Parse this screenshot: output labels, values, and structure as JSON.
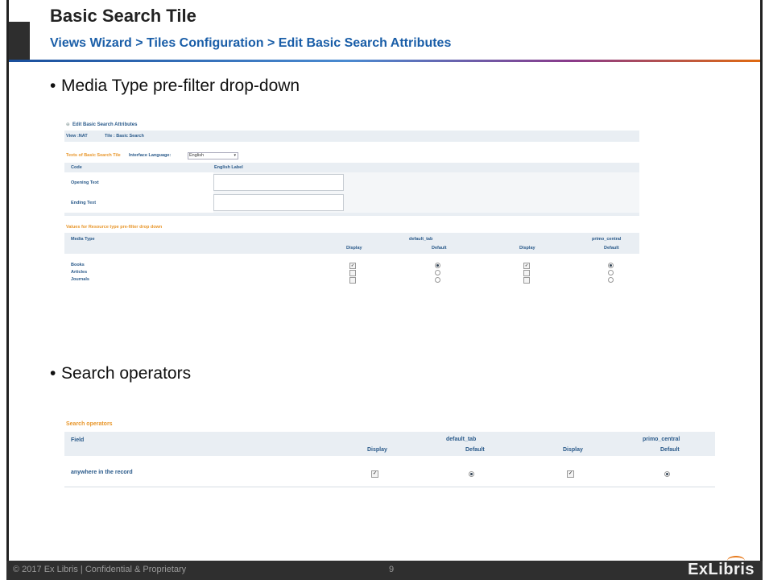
{
  "slide": {
    "title": "Basic Search Tile",
    "breadcrumb": "Views Wizard > Tiles Configuration > Edit Basic Search Attributes",
    "bullets": [
      "Media Type pre-filter drop-down",
      "Search operators"
    ]
  },
  "shot1": {
    "header": "Edit Basic Search Attributes",
    "view": "View :NAT",
    "tile": "Tile : Basic Search",
    "texts_title": "Texts of Basic Search Tile",
    "interface_language_label": "Interface Language:",
    "interface_language_value": "English",
    "code_header": "Code",
    "english_label_header": "English Label",
    "opening_text": "Opening Text",
    "ending_text": "Ending Text",
    "values_title": "Values for Resource type pre-filter drop down",
    "media_type_header": "Media Type",
    "tab1": "default_tab",
    "tab2": "primo_central",
    "display": "Display",
    "default": "Default",
    "rows": [
      {
        "label": "Books",
        "display1": true,
        "default1": true,
        "display2": true,
        "default2": true
      },
      {
        "label": "Articles",
        "display1": false,
        "default1": false,
        "display2": false,
        "default2": false
      },
      {
        "label": "Journals",
        "display1": false,
        "default1": false,
        "display2": false,
        "default2": false
      }
    ]
  },
  "shot2": {
    "title": "Search operators",
    "field_header": "Field",
    "tab1": "default_tab",
    "tab2": "primo_central",
    "display": "Display",
    "default": "Default",
    "row_label": "anywhere in the record"
  },
  "footer": {
    "copyright": "© 2017 Ex Libris | Confidential & Proprietary",
    "page": "9",
    "logo": "ExLibris"
  }
}
